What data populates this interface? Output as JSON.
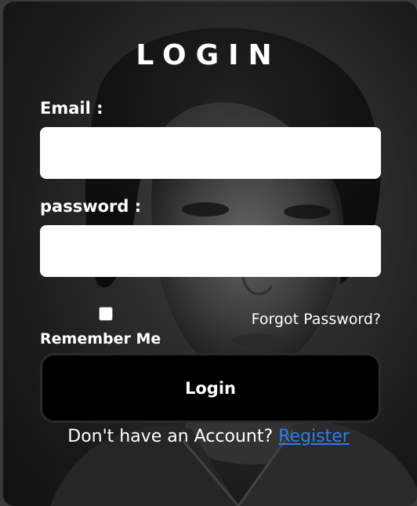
{
  "form": {
    "title": "LOGIN",
    "email_label": "Email :",
    "email_value": "",
    "password_label": "password :",
    "password_value": "",
    "remember_label": "Remember Me",
    "remember_checked": false,
    "forgot_label": "Forgot Password?",
    "login_label": "Login",
    "no_account_text": "Don't have an Account?",
    "register_label": "Register"
  },
  "colors": {
    "link": "#2f7df0",
    "button_bg": "#000000",
    "input_bg": "#ffffff"
  }
}
